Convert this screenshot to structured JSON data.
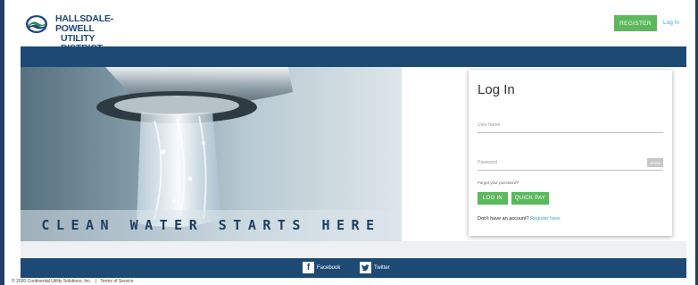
{
  "header": {
    "logo_line1": "HALLSDALE-POWELL",
    "logo_line2": "UTILITY DISTRICT",
    "register_label": "REGISTER",
    "login_link": "Log In"
  },
  "hero": {
    "tagline": "CLEAN WATER STARTS HERE"
  },
  "login": {
    "title": "Log In",
    "username_placeholder": "User Name",
    "username_value": "",
    "password_placeholder": "Password",
    "password_value": "",
    "show_label": "Show",
    "forgot_link": "Forgot your password?",
    "login_button": "LOG IN",
    "quickpay_button": "QUICK PAY",
    "no_account_text": "Don't have an account?",
    "register_link": "Register here."
  },
  "footer": {
    "facebook_label": "Facebook",
    "twitter_label": "Twitter",
    "copyright": "© 2020 Continental Utility Solutions, Inc.",
    "terms_link": "Terms of Service"
  },
  "colors": {
    "brand_navy": "#1d4a75",
    "accent_green": "#5cb85c",
    "link_blue": "#3a9fd6"
  },
  "icons": [
    "hpud-logo-icon",
    "facebook-icon",
    "twitter-icon"
  ]
}
